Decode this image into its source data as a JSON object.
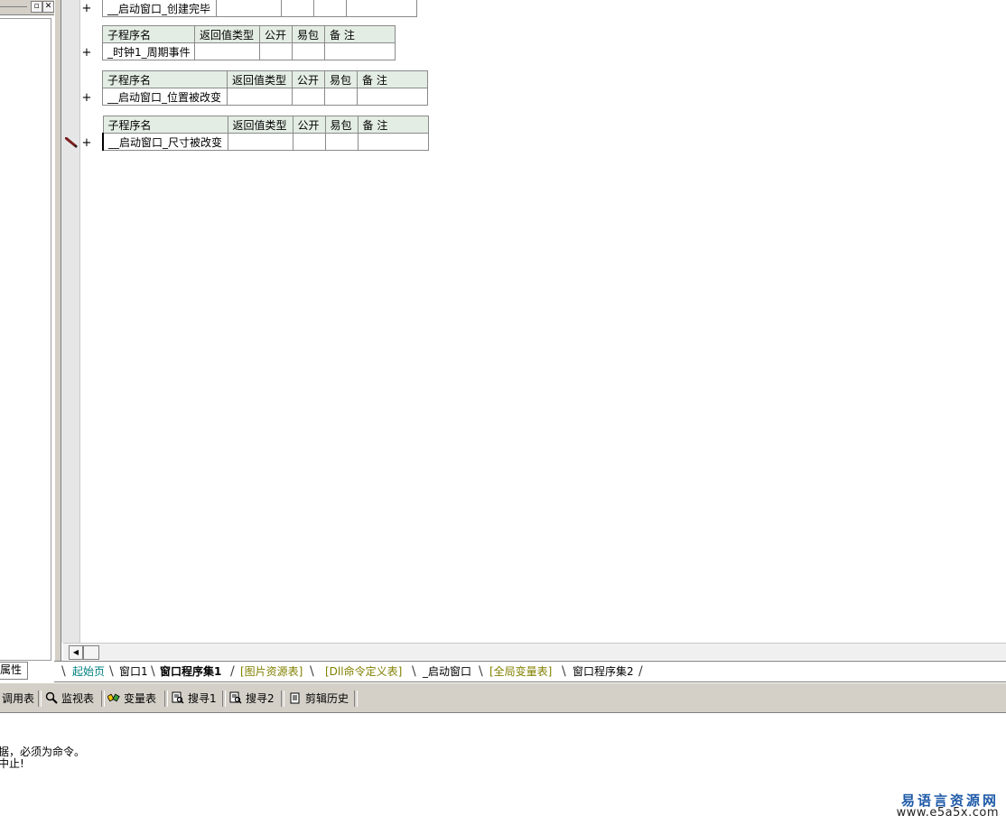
{
  "left_panel": {
    "tab_label": "属性"
  },
  "procedures": [
    {
      "headers": [],
      "name": "__启动窗口_创建完毕"
    },
    {
      "headers": [
        "子程序名",
        "返回值类型",
        "公开",
        "易包",
        "备 注"
      ],
      "name": "_时钟1_周期事件"
    },
    {
      "headers": [
        "子程序名",
        "返回值类型",
        "公开",
        "易包",
        "备 注"
      ],
      "name": "__启动窗口_位置被改变"
    },
    {
      "headers": [
        "子程序名",
        "返回值类型",
        "公开",
        "易包",
        "备 注"
      ],
      "name": "__启动窗口_尺寸被改变"
    }
  ],
  "gutter": {
    "plus": "+"
  },
  "tabs": [
    {
      "label": "起始页",
      "style": "teal"
    },
    {
      "label": "窗口1",
      "style": "normal"
    },
    {
      "label": "窗口程序集1",
      "style": "active"
    },
    {
      "label": "[图片资源表]",
      "style": "olive"
    },
    {
      "label": "[Dll命令定义表]",
      "style": "olive"
    },
    {
      "label": "_启动窗口",
      "style": "normal"
    },
    {
      "label": "[全局变量表]",
      "style": "olive"
    },
    {
      "label": "窗口程序集2",
      "style": "normal"
    }
  ],
  "toolbar": {
    "items": [
      {
        "label": "调用表",
        "icon": "call-table-icon"
      },
      {
        "label": "监视表",
        "icon": "magnifier-icon"
      },
      {
        "label": "变量表",
        "icon": "variables-icon"
      },
      {
        "label": "搜寻1",
        "icon": "search-doc-icon"
      },
      {
        "label": "搜寻2",
        "icon": "search-doc-icon"
      },
      {
        "label": "剪辑历史",
        "icon": "clipboard-icon"
      }
    ]
  },
  "output": {
    "lines": [
      "据，必须为命令。",
      "中止!"
    ]
  },
  "watermark": {
    "title": "易语言资源网",
    "url": "www.e5a5x.com"
  },
  "colors": {
    "header_bg": "#e4ede4",
    "tab_teal": "#008080",
    "tab_olive": "#808000",
    "watermark": "#1e5aa8"
  }
}
